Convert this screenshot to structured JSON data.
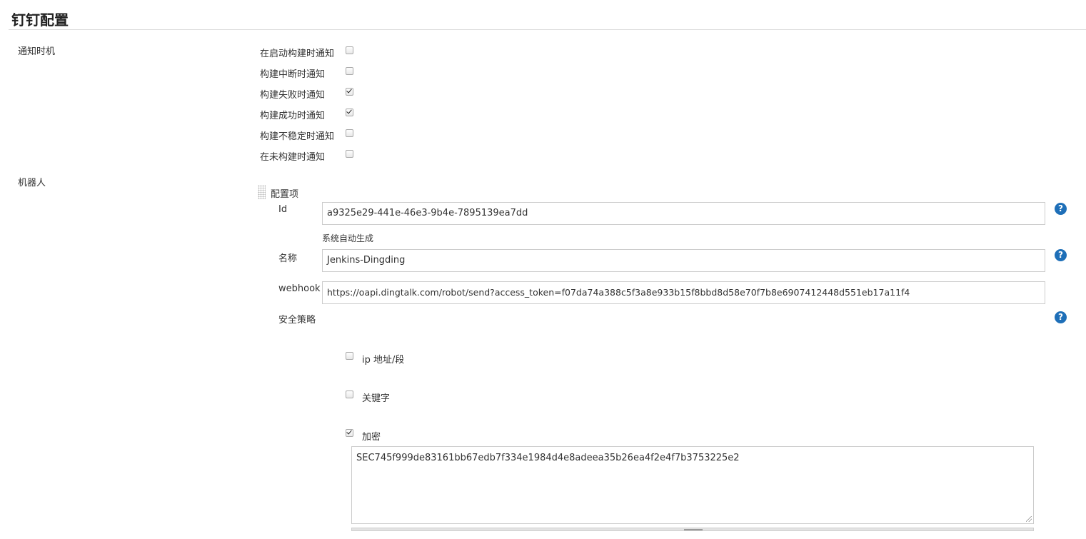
{
  "section": {
    "title": "钉钉配置"
  },
  "notify": {
    "label": "通知时机",
    "options": [
      {
        "label": "在启动构建时通知",
        "checked": false
      },
      {
        "label": "构建中断时通知",
        "checked": false
      },
      {
        "label": "构建失败时通知",
        "checked": true
      },
      {
        "label": "构建成功时通知",
        "checked": true
      },
      {
        "label": "构建不稳定时通知",
        "checked": false
      },
      {
        "label": "在未构建时通知",
        "checked": false
      }
    ]
  },
  "robot": {
    "label": "机器人",
    "item_title": "配置项",
    "id_label": "Id",
    "id_value": "a9325e29-441e-46e3-9b4e-7895139ea7dd",
    "id_hint": "系统自动生成",
    "name_label": "名称",
    "name_value": "Jenkins-Dingding",
    "webhook_label": "webhook",
    "webhook_value": "https://oapi.dingtalk.com/robot/send?access_token=f07da74a388c5f3a8e933b15f8bbd8d58e70f7b8e6907412448d551eb17a11f4",
    "security_label": "安全策略",
    "security_options": [
      {
        "label": "ip 地址/段",
        "checked": false
      },
      {
        "label": "关键字",
        "checked": false
      },
      {
        "label": "加密",
        "checked": true
      }
    ],
    "secret_value": "SEC745f999de83161bb67edb7f334e1984d4e8adeea35b26ea4f2e4f7b3753225e2"
  },
  "icons": {
    "help": "help-icon",
    "drag": "drag-handle-icon"
  },
  "colors": {
    "help": "#1e6fb8"
  }
}
